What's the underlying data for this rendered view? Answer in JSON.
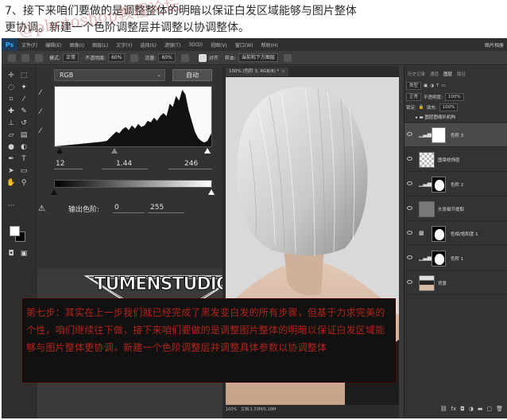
{
  "caption": {
    "line1": "7、接下来咱们要做的是调整整体的明暗以保证白发区域能够与图片整体",
    "line2": "更协调。新建一个色阶调整层并调整以协调整体。"
  },
  "watermark": "@photoshop教程论坛",
  "app": {
    "logo": "Ps",
    "menu": [
      "文件(F)",
      "编辑(E)",
      "图像(I)",
      "图层(L)",
      "文字(Y)",
      "选择(S)",
      "滤镜(T)",
      "3D(D)",
      "视图(V)",
      "窗口(W)",
      "帮助(H)"
    ],
    "right_title": "图片相册",
    "options": {
      "mode_label": "模式:",
      "mode_value": "正常",
      "opacity_label": "不透明度:",
      "opacity_value": "60%",
      "flow_label": "流量:",
      "flow_value": "60%",
      "align_label": "对齐",
      "sample_label": "样本:",
      "sample_value": "当前和下方图层"
    }
  },
  "levels": {
    "channel": "RGB",
    "auto_label": "自动",
    "input_black": "12",
    "input_gamma": "1.44",
    "input_white": "246",
    "output_label": "输出色阶:",
    "output_black": "0",
    "output_white": "255"
  },
  "document": {
    "tab": "100% (色阶 3, RGB/8) *",
    "status_zoom": "100%",
    "status_info": "文档:1.33M/5.18M"
  },
  "layers_panel": {
    "tabs": [
      "历史记录",
      "通道",
      "图层",
      "路径"
    ],
    "active_tab": "图层",
    "kind_label": "类型",
    "blend_mode": "正常",
    "opacity_label": "不透明度:",
    "opacity_value": "100%",
    "lock_label": "锁定:",
    "fill_label": "填充:",
    "fill_value": "100%",
    "group_name": "图层图缩叭机构",
    "layers": [
      {
        "name": "色阶 3"
      },
      {
        "name": "图章修饰层"
      },
      {
        "name": "色阶 2"
      },
      {
        "name": "头发细节提取"
      },
      {
        "name": "色相/饱和度 1"
      },
      {
        "name": "色阶 1"
      },
      {
        "name": "背景"
      }
    ],
    "bottom_icons": [
      "link-icon",
      "fx-icon",
      "mask-icon",
      "adjustment-icon",
      "folder-icon",
      "new-layer-icon",
      "trash-icon"
    ]
  },
  "brand_logo": "TUMENSTUDIO",
  "note": {
    "text": "第七步：其实在上一步我们就已经完成了黑发变白发的所有步骤，但基于力求完美的个性，咱们继续往下做，接下来咱们要做的是调整图片整体的明暗以保证白发区域能够与图片整体更协调，新建一个色阶调整层并调整具体参数以协调整体"
  },
  "colors": {
    "note_text": "#b0241c",
    "ps_blue": "#31a8ff"
  }
}
